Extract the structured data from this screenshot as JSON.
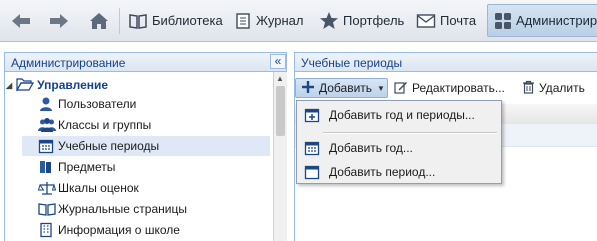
{
  "topbar": {
    "back_icon": "arrow-left-icon",
    "forward_icon": "arrow-right-icon",
    "home_icon": "home-icon",
    "items": [
      {
        "label": "Библиотека",
        "icon": "book-icon"
      },
      {
        "label": "Журнал",
        "icon": "journal-icon"
      },
      {
        "label": "Портфель",
        "icon": "star-icon"
      },
      {
        "label": "Почта",
        "icon": "mail-icon"
      },
      {
        "label": "Администрир",
        "icon": "admin-icon",
        "active": true
      }
    ]
  },
  "left_panel": {
    "title": "Администрирование",
    "collapse_glyph": "«",
    "tree_root": "Управление",
    "items": [
      {
        "label": "Пользователи",
        "icon": "user-icon"
      },
      {
        "label": "Классы и группы",
        "icon": "group-icon"
      },
      {
        "label": "Учебные периоды",
        "icon": "calendar-icon",
        "selected": true
      },
      {
        "label": "Предметы",
        "icon": "subject-icon"
      },
      {
        "label": "Шкалы оценок",
        "icon": "scale-icon"
      },
      {
        "label": "Журнальные страницы",
        "icon": "pages-icon"
      },
      {
        "label": "Информация о школе",
        "icon": "building-icon"
      }
    ]
  },
  "right_panel": {
    "title": "Учебные периоды",
    "toolbar": {
      "add_label": "Добавить",
      "edit_label": "Редактировать...",
      "delete_label": "Удалить"
    }
  },
  "add_menu": {
    "items": [
      {
        "label": "Добавить год и периоды...",
        "icon": "calendar-add-icon"
      },
      {
        "label": "Добавить год...",
        "icon": "calendar-year-icon"
      },
      {
        "label": "Добавить период...",
        "icon": "calendar-period-icon"
      }
    ]
  },
  "colors": {
    "panel_header_text": "#15428b",
    "panel_border": "#99bbe8",
    "selected_row": "#dfe8f6",
    "accent_icon": "#2a5aa0"
  }
}
